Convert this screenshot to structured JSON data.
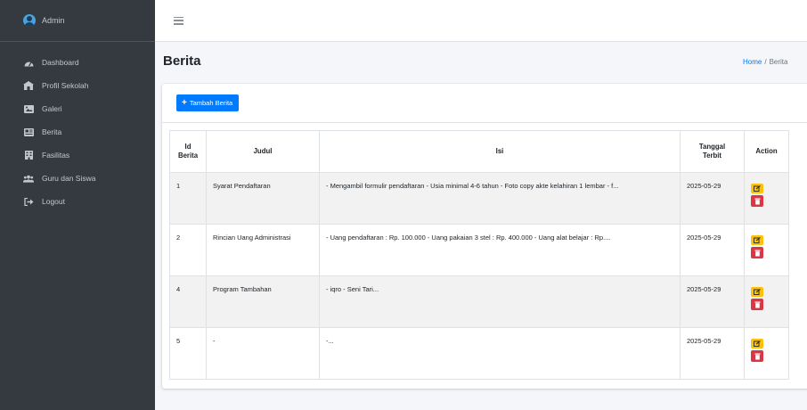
{
  "sidebar": {
    "user_name": "Admin",
    "items": [
      {
        "label": "Dashboard",
        "icon": "dashboard-icon"
      },
      {
        "label": "Profil Sekolah",
        "icon": "school-icon"
      },
      {
        "label": "Galeri",
        "icon": "image-icon"
      },
      {
        "label": "Berita",
        "icon": "newspaper-icon"
      },
      {
        "label": "Fasilitas",
        "icon": "building-icon"
      },
      {
        "label": "Guru dan Siswa",
        "icon": "users-icon"
      },
      {
        "label": "Logout",
        "icon": "logout-icon"
      }
    ]
  },
  "header": {
    "title": "Berita",
    "breadcrumb_home": "Home",
    "breadcrumb_separator": "/",
    "breadcrumb_current": "Berita"
  },
  "card": {
    "add_button_label": "Tambah Berita"
  },
  "table": {
    "headers": {
      "id_line1": "Id",
      "id_line2": "Berita",
      "judul": "Judul",
      "isi": "Isi",
      "tanggal_line1": "Tanggal",
      "tanggal_line2": "Terbit",
      "action": "Action"
    },
    "rows": [
      {
        "id": "1",
        "judul": "Syarat Pendaftaran",
        "isi": "- Mengambil formulir pendaftaran - Usia minimal 4-6 tahun - Foto copy akte kelahiran 1 lembar - f...",
        "tanggal": "2025-05-29"
      },
      {
        "id": "2",
        "judul": "Rincian Uang Administrasi",
        "isi": "- Uang pendaftaran : Rp. 100.000 - Uang pakaian 3 stel : Rp. 400.000 - Uang alat belajar : Rp....",
        "tanggal": "2025-05-29"
      },
      {
        "id": "4",
        "judul": "Program Tambahan",
        "isi": "- iqro - Seni Tari...",
        "tanggal": "2025-05-29"
      },
      {
        "id": "5",
        "judul": "-",
        "isi": "-...",
        "tanggal": "2025-05-29"
      }
    ]
  },
  "colors": {
    "sidebar_bg": "#343a40",
    "primary": "#007bff",
    "warning": "#ffc107",
    "danger": "#dc3545"
  }
}
